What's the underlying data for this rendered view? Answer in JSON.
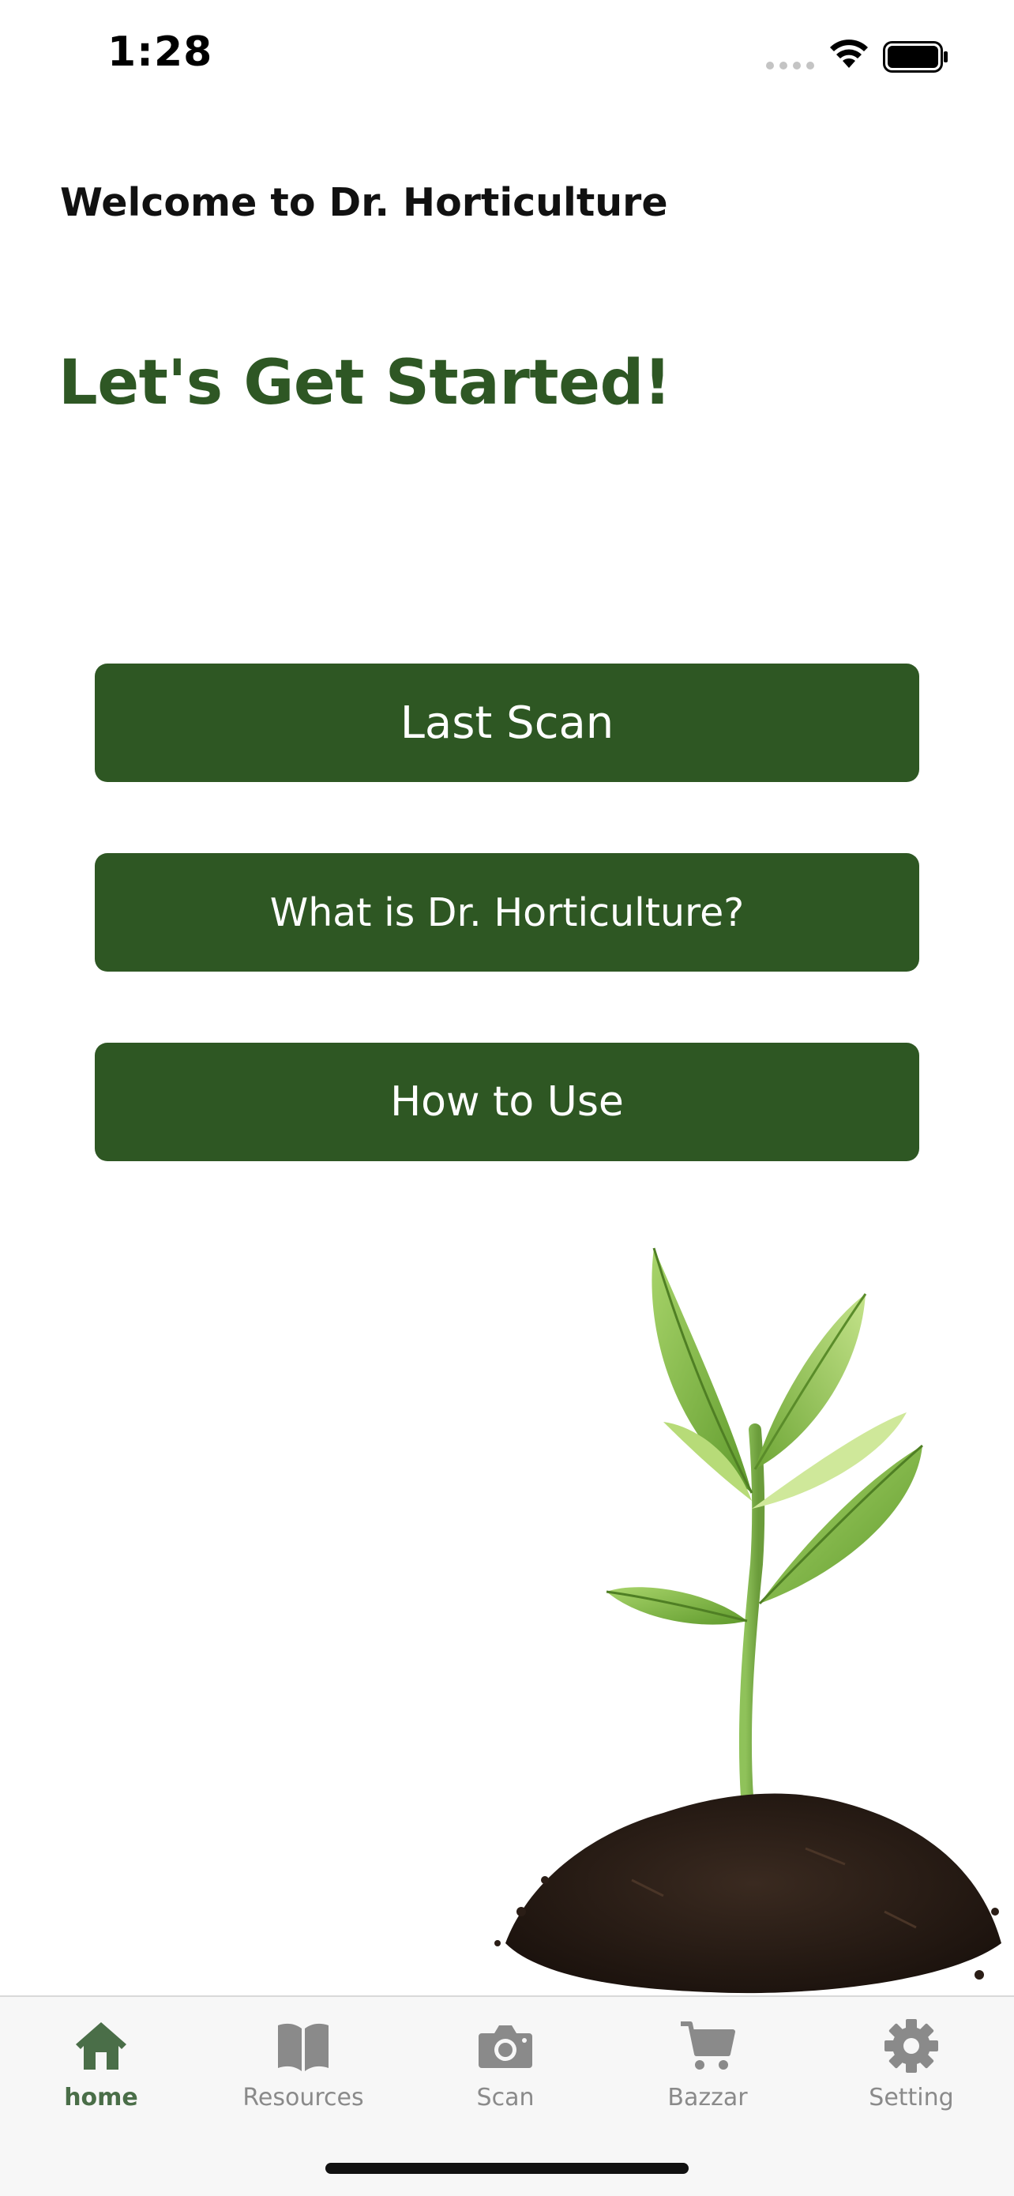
{
  "status_bar": {
    "time": "1:28"
  },
  "header": {
    "welcome": "Welcome to Dr. Horticulture",
    "headline": "Let's Get Started!"
  },
  "buttons": {
    "last_scan": "Last Scan",
    "what_is": "What is Dr. Horticulture?",
    "how_to_use": "How to Use"
  },
  "tab_bar": {
    "items": [
      {
        "label": "home",
        "icon": "house-icon",
        "active": true
      },
      {
        "label": "Resources",
        "icon": "book-icon",
        "active": false
      },
      {
        "label": "Scan",
        "icon": "camera-icon",
        "active": false
      },
      {
        "label": "Bazzar",
        "icon": "cart-icon",
        "active": false
      },
      {
        "label": "Setting",
        "icon": "gear-icon",
        "active": false
      }
    ]
  },
  "colors": {
    "brand_green": "#2e5723",
    "active_tab": "#4a6e48",
    "inactive_tab": "#8a8a8a"
  }
}
